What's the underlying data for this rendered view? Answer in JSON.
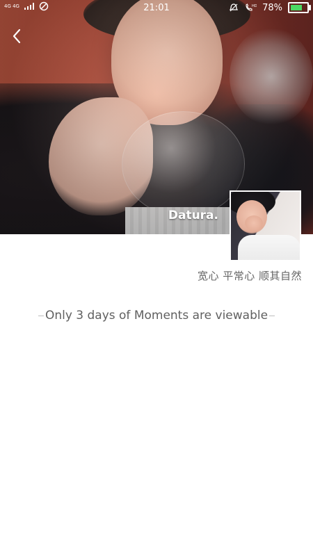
{
  "status_bar": {
    "network": "4G 4G",
    "time": "21:01",
    "battery": "78%",
    "battery_level": 0.78,
    "icons": [
      "signal-icon",
      "no-disturb-icon",
      "alarm-icon",
      "hd-call-icon",
      "battery-icon"
    ]
  },
  "header": {
    "back_icon": "chevron-left-icon"
  },
  "profile": {
    "name": "Datura.",
    "signature": "宽心 平常心 顺其自然"
  },
  "moments": {
    "notice": "Only 3 days of Moments are viewable"
  },
  "colors": {
    "background": "#ffffff",
    "status_text": "#ffffff",
    "signature_text": "#666666",
    "notice_text": "#606060",
    "battery_fill": "#4cd964"
  }
}
